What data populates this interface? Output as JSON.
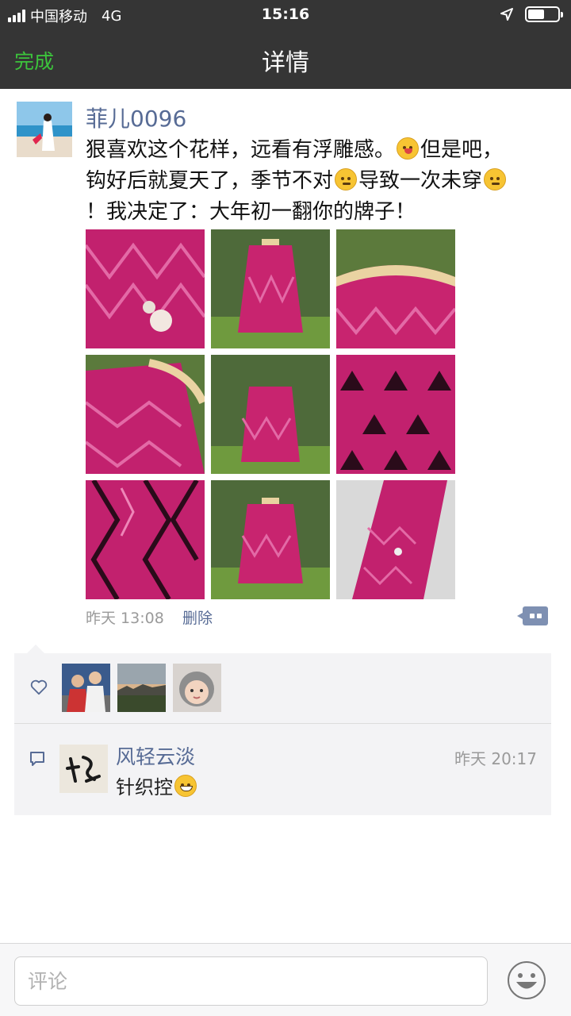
{
  "status_bar": {
    "carrier": "中国移动",
    "network": "4G",
    "time": "15:16",
    "battery_level": 0.55
  },
  "nav": {
    "back_label": "完成",
    "title": "详情"
  },
  "post": {
    "author": "菲儿0096",
    "text_lines": [
      [
        "狠喜欢这个花样，远看有浮雕感。",
        "但是吧，"
      ],
      [
        "钩好后就夏天了，季节不对",
        "导致一次未穿",
        ""
      ],
      [
        "！我决定了：大年初一翻你的牌子！"
      ]
    ],
    "inline_emojis": [
      "tongue-out-emoji",
      "dizzy-face-emoji",
      "dizzy-face-emoji"
    ],
    "photo_count": 9,
    "time": "昨天 13:08",
    "delete_label": "删除"
  },
  "likes": {
    "liker_avatar_count": 3
  },
  "comments": [
    {
      "author": "风轻云淡",
      "time": "昨天 20:17",
      "text": "针织控",
      "emoji": "grinning-emoji"
    }
  ],
  "input": {
    "placeholder": "评论"
  },
  "colors": {
    "nav_bg": "#353535",
    "done_green": "#3cc33c",
    "link_blue": "#576b95",
    "panel_bg": "#f3f3f5",
    "sweater_pink": "#c81e6e"
  }
}
